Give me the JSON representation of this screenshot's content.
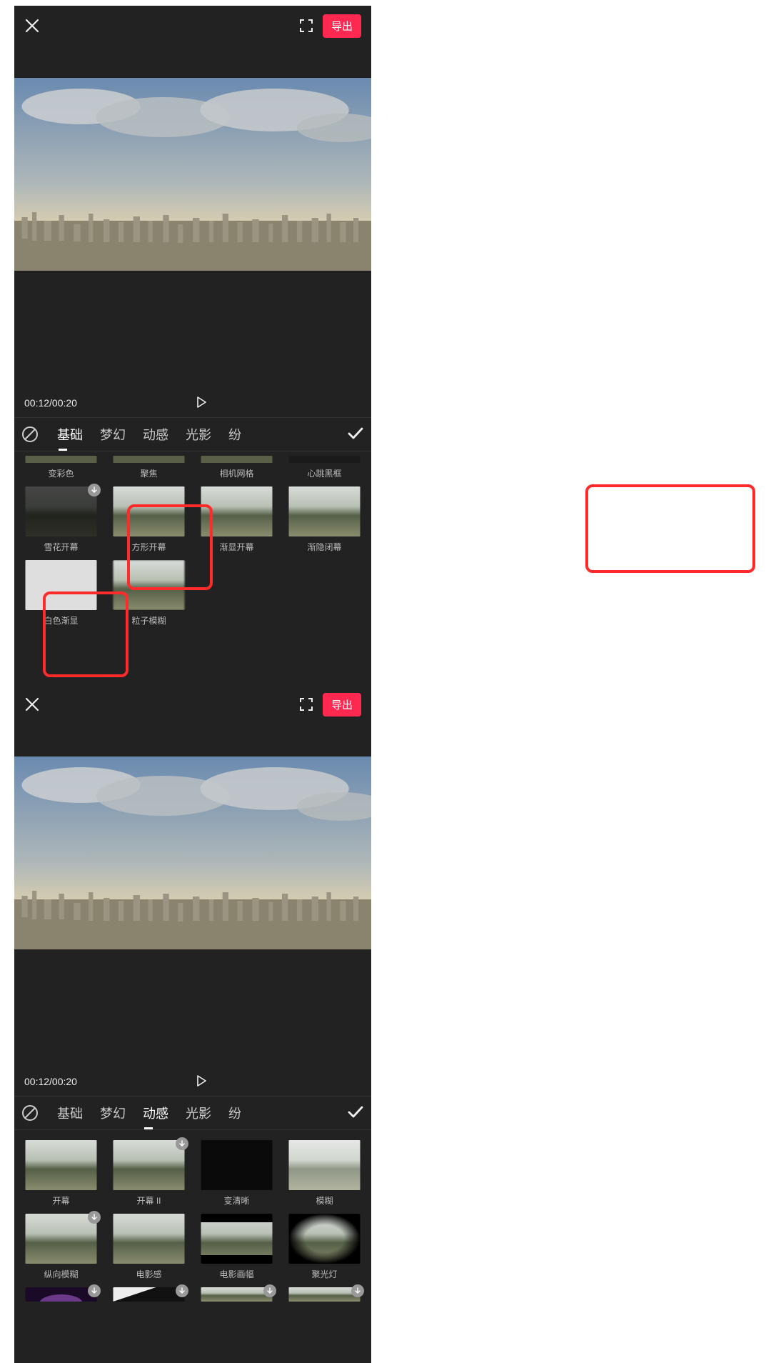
{
  "header": {
    "export_label": "导出"
  },
  "playback": {
    "time": "00:12/00:20"
  },
  "tabs": [
    "基础",
    "梦幻",
    "动感",
    "光影",
    "纷"
  ],
  "panel_left": {
    "active_tab_index": 0,
    "row0": [
      {
        "label": "变彩色",
        "download": false
      },
      {
        "label": "聚焦",
        "download": false
      },
      {
        "label": "相机网格",
        "download": false
      },
      {
        "label": "心跳黑框",
        "download": false
      }
    ],
    "row1": [
      {
        "label": "雪花开幕",
        "download": true,
        "thumb": "scene_dark"
      },
      {
        "label": "方形开幕",
        "download": false,
        "thumb": "scene"
      },
      {
        "label": "渐显开幕",
        "download": false,
        "thumb": "scene"
      },
      {
        "label": "渐隐闭幕",
        "download": false,
        "thumb": "scene"
      }
    ],
    "row2": [
      {
        "label": "白色渐显",
        "download": false,
        "thumb": "white"
      },
      {
        "label": "粒子模糊",
        "download": false,
        "thumb": "scene_blur"
      }
    ]
  },
  "panel_right": {
    "active_tab_index": 2,
    "row0": [
      {
        "label": "开幕",
        "download": false,
        "thumb": "scene"
      },
      {
        "label": "开幕 II",
        "download": true,
        "thumb": "scene"
      },
      {
        "label": "变清晰",
        "download": false,
        "thumb": "black"
      },
      {
        "label": "模糊",
        "download": false,
        "thumb": "scene_blur2"
      }
    ],
    "row1": [
      {
        "label": "纵向模糊",
        "download": true,
        "thumb": "scene_vblur"
      },
      {
        "label": "电影感",
        "download": false,
        "thumb": "scene"
      },
      {
        "label": "电影画幅",
        "download": false,
        "thumb": "scene_bars"
      },
      {
        "label": "聚光灯",
        "download": false,
        "thumb": "scene_vignette"
      }
    ],
    "row2_thumbs": [
      {
        "download": true,
        "thumb": "dark_purple"
      },
      {
        "download": true,
        "thumb": "dark_triangle"
      },
      {
        "download": true,
        "thumb": "scene"
      },
      {
        "download": true,
        "thumb": "scene"
      }
    ]
  }
}
